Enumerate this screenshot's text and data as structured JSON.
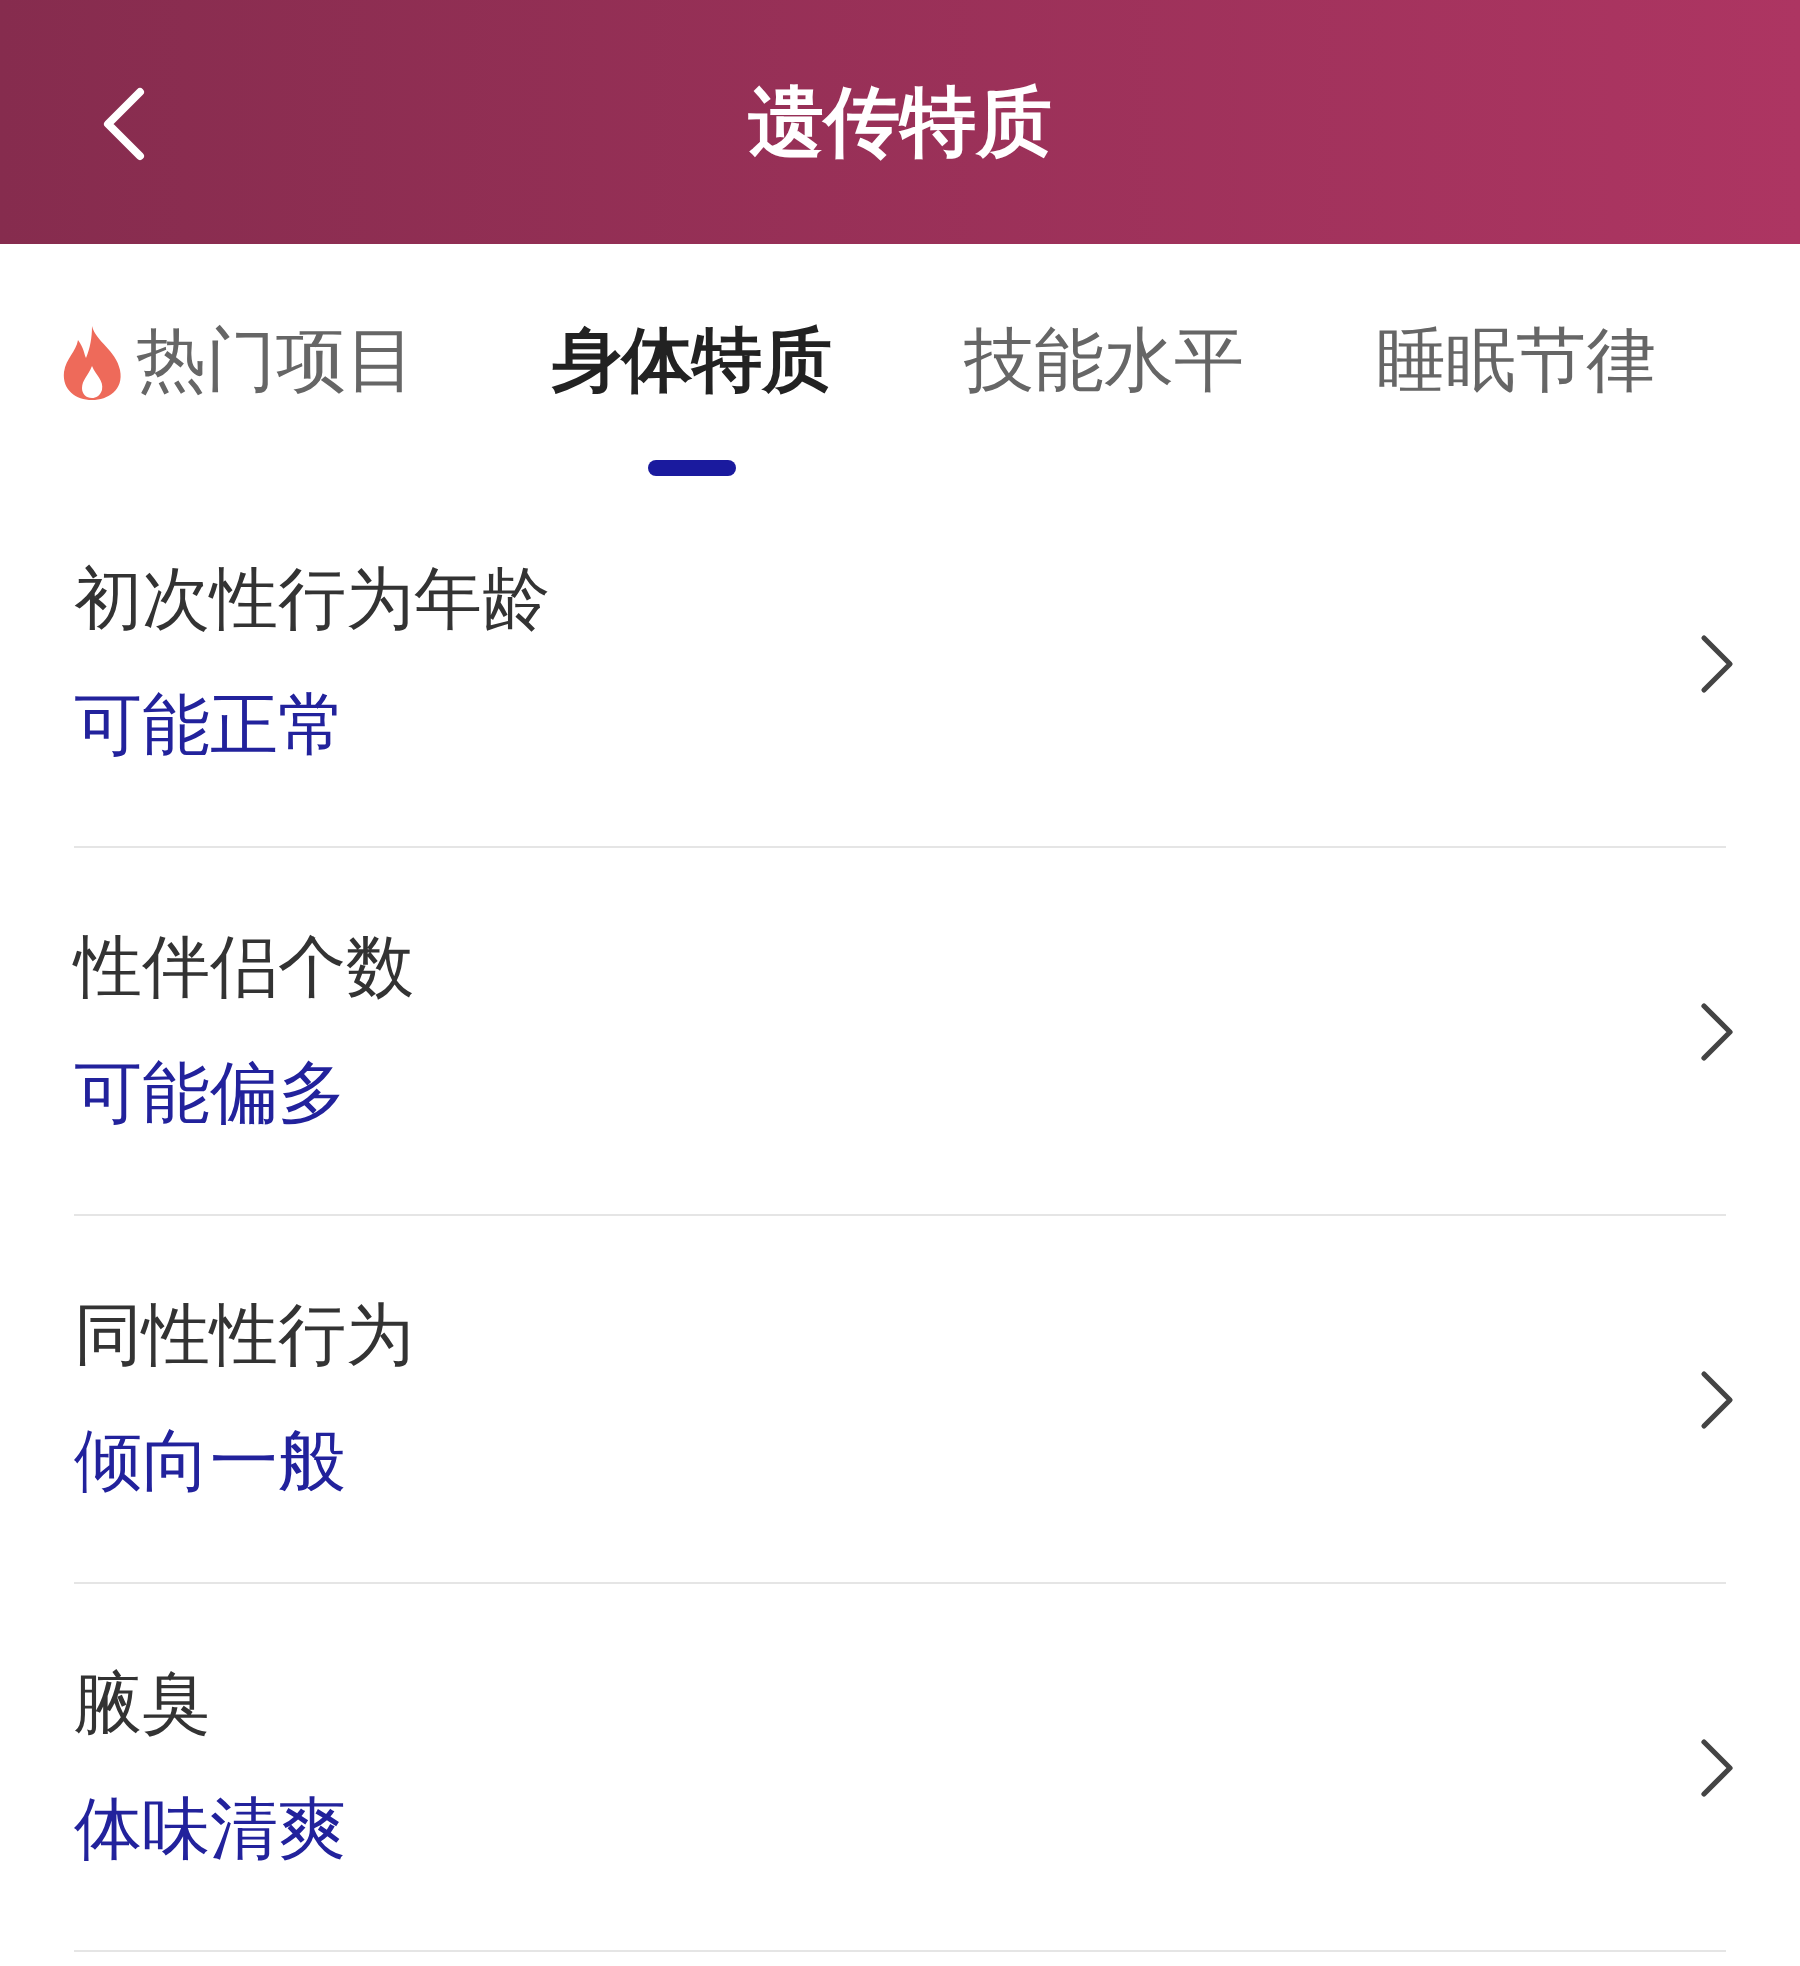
{
  "header": {
    "title": "遗传特质"
  },
  "tabs": [
    {
      "label": "热门项目",
      "kind": "hot",
      "selected": false
    },
    {
      "label": "身体特质",
      "kind": "plain",
      "selected": true
    },
    {
      "label": "技能水平",
      "kind": "plain",
      "selected": false
    },
    {
      "label": "睡眠节律",
      "kind": "plain",
      "selected": false
    }
  ],
  "items": [
    {
      "title": "初次性行为年龄",
      "value": "可能正常"
    },
    {
      "title": "性伴侣个数",
      "value": "可能偏多"
    },
    {
      "title": "同性性行为",
      "value": "倾向一般"
    },
    {
      "title": "腋臭",
      "value": "体味清爽"
    }
  ]
}
